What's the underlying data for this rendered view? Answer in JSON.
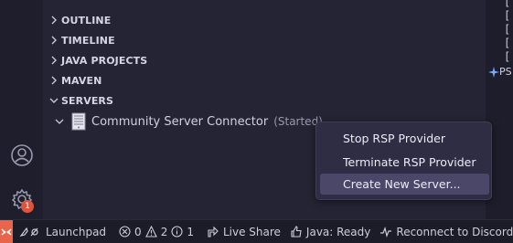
{
  "sidebar": {
    "sections": [
      "OUTLINE",
      "TIMELINE",
      "JAVA PROJECTS",
      "MAVEN",
      "SERVERS"
    ],
    "server": {
      "name": "Community Server Connector",
      "status": "(Started)"
    }
  },
  "context_menu": {
    "items": [
      "Stop RSP Provider",
      "Terminate RSP Provider",
      "Create New Server..."
    ],
    "selected_index": 2
  },
  "activity_bar": {
    "settings_badge": "1"
  },
  "editor": {
    "brackets": [
      "[",
      "[",
      "[",
      "[",
      "["
    ],
    "ps_label": "PS"
  },
  "statusbar": {
    "launchpad": "Launchpad",
    "errors": "0",
    "warnings": "2",
    "infos": "1",
    "live_share": "Live Share",
    "java_status": "Java: Ready",
    "discord": "Reconnect to Discord"
  },
  "colors": {
    "accent_remote": "#e8644b",
    "menu_bg": "#2f2d44",
    "menu_selected": "#4a4768",
    "badge": "#e0533b"
  }
}
